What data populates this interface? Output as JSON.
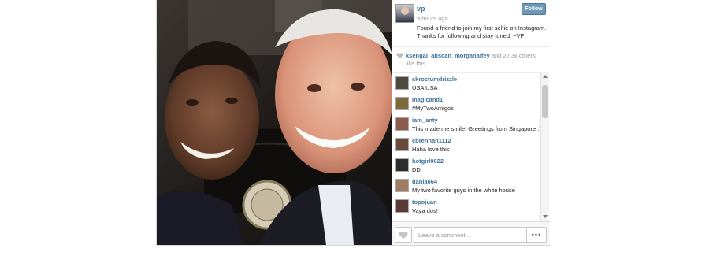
{
  "post": {
    "username": "vp",
    "time_ago": "9 hours ago",
    "caption": "Found a friend to join my first selfie on Instagram. Thanks for following and stay tuned. ~VP",
    "follow_label": "Follow",
    "photo_icon": "selfie-photo"
  },
  "likes": {
    "users": [
      "ksengal",
      "abscan",
      "morganalfey"
    ],
    "others": "and 22.3k others like this.",
    "icon": "heart-icon"
  },
  "comments": [
    {
      "user": "skroctumdrizzle",
      "text": "USA USA",
      "avatar_color": "#4b4a3c"
    },
    {
      "user": "magicand1",
      "text": "#MyTwoAmigos",
      "avatar_color": "#7d6a3a"
    },
    {
      "user": "iam_anty",
      "text": "This made me smile! Greetings from Singapore :)",
      "avatar_color": "#8b5a4a"
    },
    {
      "user": "cbrennan1112",
      "text": "Haha love this",
      "avatar_color": "#6a4a3a"
    },
    {
      "user": "hotgirl0622",
      "text": "DD",
      "avatar_color": "#2d2d2d"
    },
    {
      "user": "dania664",
      "text": "My two favorite guys in the white house",
      "avatar_color": "#a07d62"
    },
    {
      "user": "topojuan",
      "text": "Vaya dos!",
      "avatar_color": "#5a3a36"
    }
  ],
  "composer": {
    "placeholder": "Leave a comment...",
    "more_label": "•••"
  },
  "colors": {
    "link": "#3f729b",
    "follow_bg": "#6f97b6"
  }
}
